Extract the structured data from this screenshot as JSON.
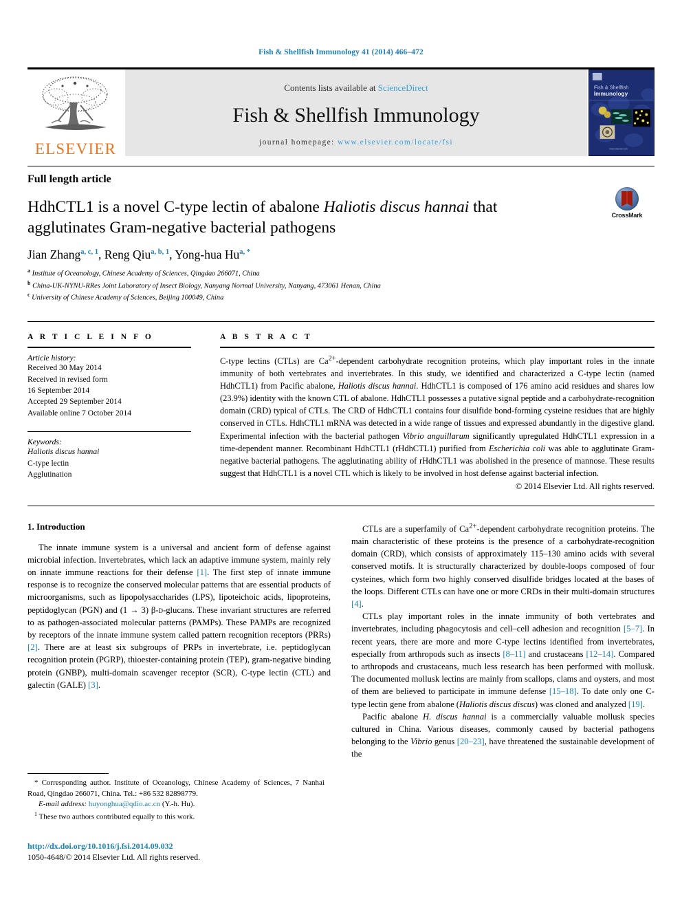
{
  "running_head": "Fish & Shellfish Immunology 41 (2014) 466–472",
  "masthead": {
    "publisher_name": "ELSEVIER",
    "contents_prefix": "Contents lists available at ",
    "contents_link": "ScienceDirect",
    "journal_title": "Fish & Shellfish Immunology",
    "homepage_prefix": "journal homepage: ",
    "homepage_url": "www.elsevier.com/locate/fsi",
    "cover_title_line1": "Fish & Shellfish",
    "cover_title_line2": "Immunology",
    "cover_footer": "www.elsevier.com/locate/fsi",
    "band_color": "#e6e6e6",
    "link_color": "#3b9fd4",
    "elsevier_orange": "#E87722",
    "cover_bg": "#1b2a6b"
  },
  "article": {
    "type": "Full length article",
    "title_part1": "HdhCTL1 is a novel C-type lectin of abalone ",
    "title_species": "Haliotis discus hannai",
    "title_part2": " that agglutinates Gram-negative bacterial pathogens",
    "crossmark_label": "CrossMark",
    "authors": [
      {
        "name": "Jian Zhang",
        "marks": "a, c, 1",
        "sep": ", "
      },
      {
        "name": "Reng Qiu",
        "marks": "a, b, 1",
        "sep": ", "
      },
      {
        "name": "Yong-hua Hu",
        "marks": "a, *",
        "sep": ""
      }
    ],
    "affiliations": [
      {
        "mark": "a",
        "text": "Institute of Oceanology, Chinese Academy of Sciences, Qingdao 266071, China"
      },
      {
        "mark": "b",
        "text": "China-UK-NYNU-RRes Joint Laboratory of Insect Biology, Nanyang Normal University, Nanyang, 473061 Henan, China"
      },
      {
        "mark": "c",
        "text": "University of Chinese Academy of Sciences, Beijing 100049, China"
      }
    ]
  },
  "article_info": {
    "heading": "A R T I C L E  I N F O",
    "history_label": "Article history:",
    "history": [
      "Received 30 May 2014",
      "Received in revised form",
      "16 September 2014",
      "Accepted 29 September 2014",
      "Available online 7 October 2014"
    ],
    "keywords_label": "Keywords:",
    "keywords": [
      {
        "text": "Haliotis discus hannai",
        "italic": true
      },
      {
        "text": "C-type lectin",
        "italic": false
      },
      {
        "text": "Agglutination",
        "italic": false
      }
    ]
  },
  "abstract": {
    "heading": "A B S T R A C T",
    "paragraphs": [
      "C-type lectins (CTLs) are Ca2+-dependent carbohydrate recognition proteins, which play important roles in the innate immunity of both vertebrates and invertebrates. In this study, we identified and characterized a C-type lectin (named HdhCTL1) from Pacific abalone, Haliotis discus hannai. HdhCTL1 is composed of 176 amino acid residues and shares low (23.9%) identity with the known CTL of abalone. HdhCTL1 possesses a putative signal peptide and a carbohydrate-recognition domain (CRD) typical of CTLs. The CRD of HdhCTL1 contains four disulfide bond-forming cysteine residues that are highly conserved in CTLs. HdhCTL1 mRNA was detected in a wide range of tissues and expressed abundantly in the digestive gland. Experimental infection with the bacterial pathogen Vibrio anguillarum significantly upregulated HdhCTL1 expression in a time-dependent manner. Recombinant HdhCTL1 (rHdhCTL1) purified from Escherichia coli was able to agglutinate Gram-negative bacterial pathogens. The agglutinating ability of rHdhCTL1 was abolished in the presence of mannose. These results suggest that HdhCTL1 is a novel CTL which is likely to be involved in host defense against bacterial infection."
    ],
    "copyright": "© 2014 Elsevier Ltd. All rights reserved."
  },
  "introduction": {
    "section_title": "1. Introduction",
    "left_paragraphs": [
      "The innate immune system is a universal and ancient form of defense against microbial infection. Invertebrates, which lack an adaptive immune system, mainly rely on innate immune reactions for their defense [1]. The first step of innate immune response is to recognize the conserved molecular patterns that are essential products of microorganisms, such as lipopolysaccharides (LPS), lipoteichoic acids, lipoproteins, peptidoglycan (PGN) and (1 → 3) β-D-glucans. These invariant structures are referred to as pathogen-associated molecular patterns (PAMPs). These PAMPs are recognized by receptors of the innate immune system called pattern recognition receptors (PRRs) [2]. There are at least six subgroups of PRPs in invertebrate, i.e. peptidoglycan recognition protein (PGRP), thioester-containing protein (TEP), gram-negative binding protein (GNBP), multi-domain scavenger receptor (SCR), C-type lectin (CTL) and galectin (GALE) [3]."
    ],
    "right_paragraphs": [
      "CTLs are a superfamily of Ca2+-dependent carbohydrate recognition proteins. The main characteristic of these proteins is the presence of a carbohydrate-recognition domain (CRD), which consists of approximately 115–130 amino acids with several conserved motifs. It is structurally characterized by double-loops composed of four cysteines, which form two highly conserved disulfide bridges located at the bases of the loops. Different CTLs can have one or more CRDs in their multi-domain structures [4].",
      "CTLs play important roles in the innate immunity of both vertebrates and invertebrates, including phagocytosis and cell–cell adhesion and recognition [5–7]. In recent years, there are more and more C-type lectins identified from invertebrates, especially from arthropods such as insects [8–11] and crustaceans [12–14]. Compared to arthropods and crustaceans, much less research has been performed with mollusk. The documented mollusk lectins are mainly from scallops, clams and oysters, and most of them are believed to participate in immune defense [15–18]. To date only one C-type lectin gene from abalone (Haliotis discus discus) was cloned and analyzed [19].",
      "Pacific abalone H. discus hannai is a commercially valuable mollusk species cultured in China. Various diseases, commonly caused by bacterial pathogens belonging to the Vibrio genus [20–23], have threatened the sustainable development of the"
    ]
  },
  "footnotes": {
    "corresponding": "* Corresponding author. Institute of Oceanology, Chinese Academy of Sciences, 7 Nanhai Road, Qingdao 266071, China. Tel.: +86 532 82898779.",
    "email_label": "E-mail address:",
    "email": "huyonghua@qdio.ac.cn",
    "email_suffix": " (Y.-h. Hu).",
    "equal_contrib_mark": "1",
    "equal_contrib": "These two authors contributed equally to this work."
  },
  "doi": {
    "url": "http://dx.doi.org/10.1016/j.fsi.2014.09.032",
    "issn_line": "1050-4648/© 2014 Elsevier Ltd. All rights reserved."
  }
}
